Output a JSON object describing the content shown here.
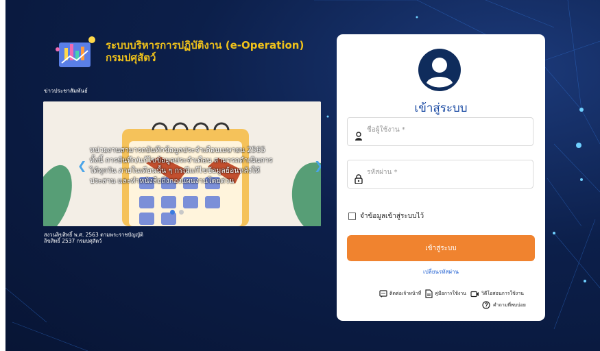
{
  "brand": {
    "title_line1": "ระบบบริหารการปฏิบัติงาน (e-Operation)",
    "title_line2": "กรมปศุสัตว์"
  },
  "news": {
    "label": "ข่าวประชาสัมพันธ์",
    "slide_text": "หน่วยงานสามารถบันทึกข้อมูลประจำเดือนเมษายน 2565 ทั้งนี้ การบันทึก/แก้ไขข้อมูลประจำเดือน สามารถดำเนินการได้ทุกวัน ภายในเดือนนั้น ๆ กรณีแก้ไขข้อมูลย้อนหลังให้ประสาน และทำหนังสือถึงกองแผนงานโดยด่วน",
    "slide_count": 2,
    "active_slide": 1
  },
  "copyright": {
    "line1": "สงวนลิขสิทธิ์ พ.ศ. 2563 ตามพระราชบัญญัติ",
    "line2": "ลิขสิทธิ์ 2537 กรมปศุสัตว์"
  },
  "login": {
    "title": "เข้าสู่ระบบ",
    "username_placeholder": "ชื่อผู้ใช้งาน *",
    "password_placeholder": "รหัสผ่าน *",
    "remember_label": "จำข้อมูลเข้าสู่ระบบไว้",
    "submit_label": "เข้าสู่ระบบ",
    "forgot_label": "เปลี่ยนรหัสผ่าน"
  },
  "help": {
    "contact_label": "ติดต่อเจ้าหน้าที่",
    "manual_label": "คู่มือการใช้งาน",
    "video_label": "วิดีโอสอนการใช้งาน",
    "faq_label": "คำถามที่พบบ่อย"
  },
  "colors": {
    "brand_yellow": "#f0c21a",
    "login_title": "#1a4aa3",
    "submit_bg": "#f0832f",
    "background": "#0c1f4a"
  },
  "icons": [
    "user-avatar-icon",
    "user-icon",
    "lock-icon",
    "checkbox-icon",
    "chat-icon",
    "document-icon",
    "video-icon",
    "question-icon",
    "chevron-left-icon",
    "chevron-right-icon"
  ]
}
